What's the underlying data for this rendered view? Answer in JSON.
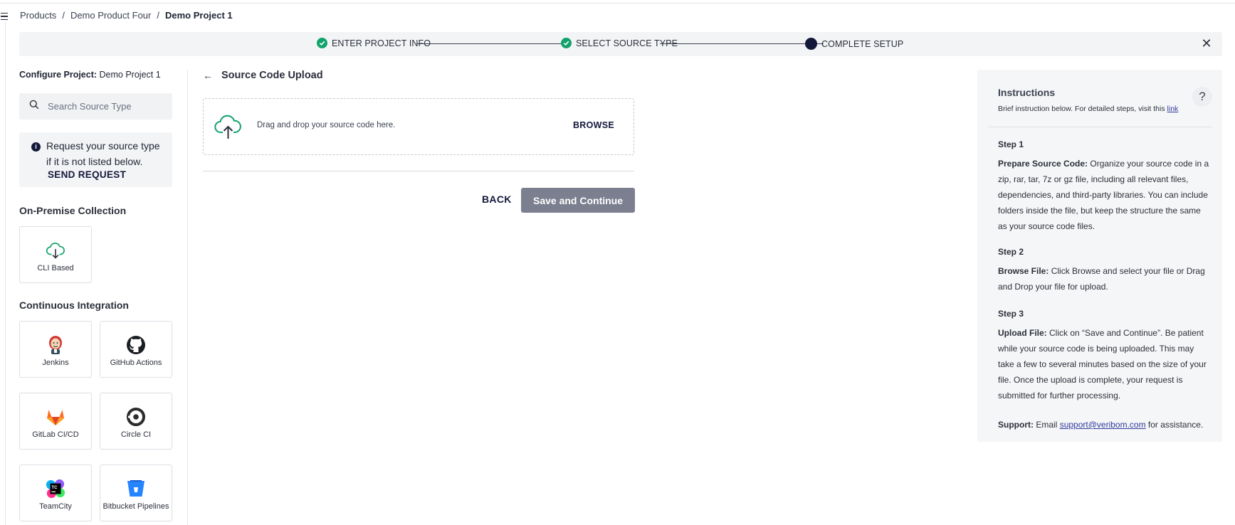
{
  "breadcrumb": {
    "items": [
      "Products",
      "Demo Product Four"
    ],
    "current": "Demo Project 1",
    "separator": "/"
  },
  "stepper": {
    "steps": [
      {
        "label": "ENTER PROJECT INFO",
        "status": "complete"
      },
      {
        "label": "SELECT SOURCE TYPE",
        "status": "complete"
      },
      {
        "label": "COMPLETE SETUP",
        "status": "current"
      }
    ],
    "close_icon": "close-icon"
  },
  "sidebar": {
    "config_label": "Configure Project:",
    "config_value": "Demo Project 1",
    "search": {
      "placeholder": "Search Source Type",
      "value": ""
    },
    "request": {
      "message": "Request your source type if it is not listed below.",
      "action": "SEND REQUEST"
    },
    "sections": [
      {
        "title": "On-Premise Collection",
        "items": [
          {
            "label": "CLI Based",
            "icon": "cloud-download-icon"
          }
        ]
      },
      {
        "title": "Continuous Integration",
        "items": [
          {
            "label": "Jenkins",
            "icon": "jenkins-icon"
          },
          {
            "label": "GitHub Actions",
            "icon": "github-icon"
          },
          {
            "label": "GitLab CI/CD",
            "icon": "gitlab-icon"
          },
          {
            "label": "Circle CI",
            "icon": "circleci-icon"
          },
          {
            "label": "TeamCity",
            "icon": "teamcity-icon"
          },
          {
            "label": "Bitbucket Pipelines",
            "icon": "bitbucket-icon"
          }
        ]
      }
    ]
  },
  "main": {
    "title": "Source Code Upload",
    "dropzone": {
      "text": "Drag and drop your source code here.",
      "browse": "BROWSE"
    },
    "back_label": "BACK",
    "save_label": "Save and Continue"
  },
  "instructions": {
    "title": "Instructions",
    "subtitle": "Brief instruction below. For detailed steps, visit this",
    "subtitle_link": "link",
    "help": "?",
    "steps": [
      {
        "heading": "Step 1",
        "bold": "Prepare Source Code:",
        "text": " Organize your source code in a zip, rar, tar, 7z or gz file, including all relevant files, dependencies, and third-party libraries. You can include folders inside the file, but keep the structure the same as your source code files."
      },
      {
        "heading": "Step 2",
        "bold": "Browse File:",
        "text": " Click Browse and select your file or Drag and Drop your file for upload."
      },
      {
        "heading": "Step 3",
        "bold": "Upload File:",
        "text": " Click on “Save and Continue”. Be patient while your source code is being uploaded. This may take a few to several minutes based on the size of your file. Once the upload is complete, your request is submitted for further processing."
      }
    ],
    "support": {
      "bold": "Support:",
      "prefix": " Email ",
      "email": "support@veribom.com",
      "suffix": " for assistance."
    }
  },
  "colors": {
    "accent": "#14183b",
    "success": "#12a26b",
    "button_disabled": "#7b7f8f"
  }
}
